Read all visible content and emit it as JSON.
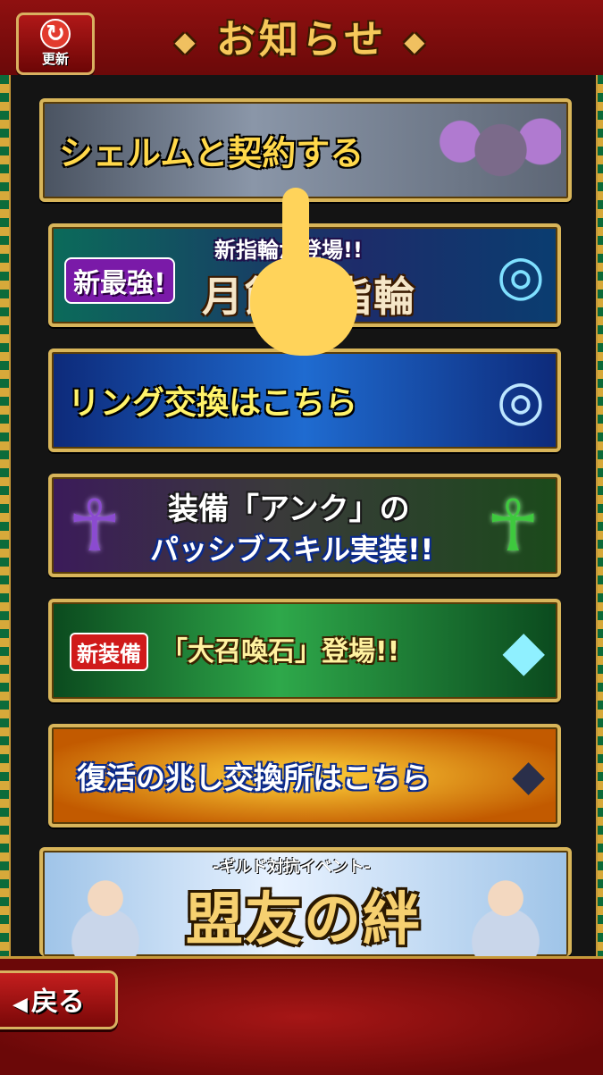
{
  "header": {
    "title": "お知らせ",
    "left_deco": "◆",
    "right_deco": "◆",
    "refresh_label": "更新",
    "refresh_icon": "↻"
  },
  "banners": [
    {
      "text": "シェルムと契約する"
    },
    {
      "tag": "新最強!",
      "subtitle": "新指輪が登場!!",
      "main": "月蝕の指輪"
    },
    {
      "text": "リング交換はこちら"
    },
    {
      "line1": "装備「アンク」の",
      "line2": "パッシブスキル実装!!"
    },
    {
      "tag": "新装備",
      "main": "「大召喚石」登場!!"
    },
    {
      "text": "復活の兆し交換所はこちら"
    },
    {
      "subtitle": "-ギルド対抗イベント-",
      "main": "盟友の絆"
    }
  ],
  "footer": {
    "back_label": "戻る",
    "back_icon": "◀"
  },
  "colors": {
    "frame_red": "#7a0c0c",
    "gold": "#d8b55a",
    "panel_bg": "#141414",
    "hand": "#ffd35a"
  }
}
